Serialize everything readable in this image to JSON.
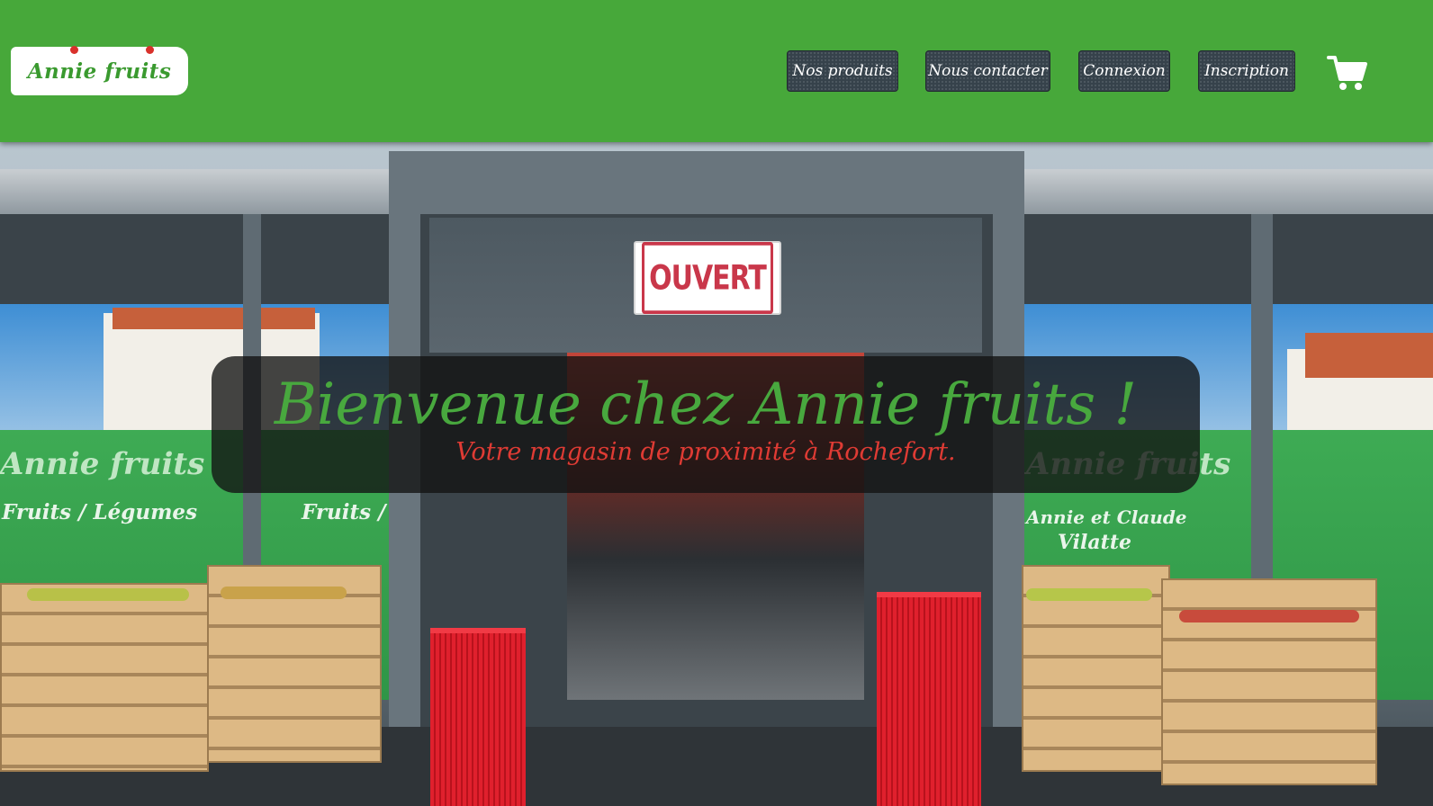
{
  "header": {
    "logo_text": "Annie fruits",
    "nav": [
      {
        "label": "Nos produits"
      },
      {
        "label": "Nous contacter"
      },
      {
        "label": "Connexion"
      },
      {
        "label": "Inscription"
      }
    ],
    "cart_icon": "shopping-cart-icon"
  },
  "hero": {
    "title": "Bienvenue chez Annie fruits !",
    "subtitle": "Votre magasin de proximité à Rochefort.",
    "photo": {
      "sign_text": "OUVERT",
      "window_brand": "Annie fruits",
      "window_left": "Fruits / Légumes",
      "window_right_line1": "Annie et Claude",
      "window_right_line2": "Vilatte"
    }
  },
  "colors": {
    "header_bg": "#47a83a",
    "button_bg": "#36424b",
    "title_green": "#48a83e",
    "subtitle_red": "#df3b34"
  }
}
